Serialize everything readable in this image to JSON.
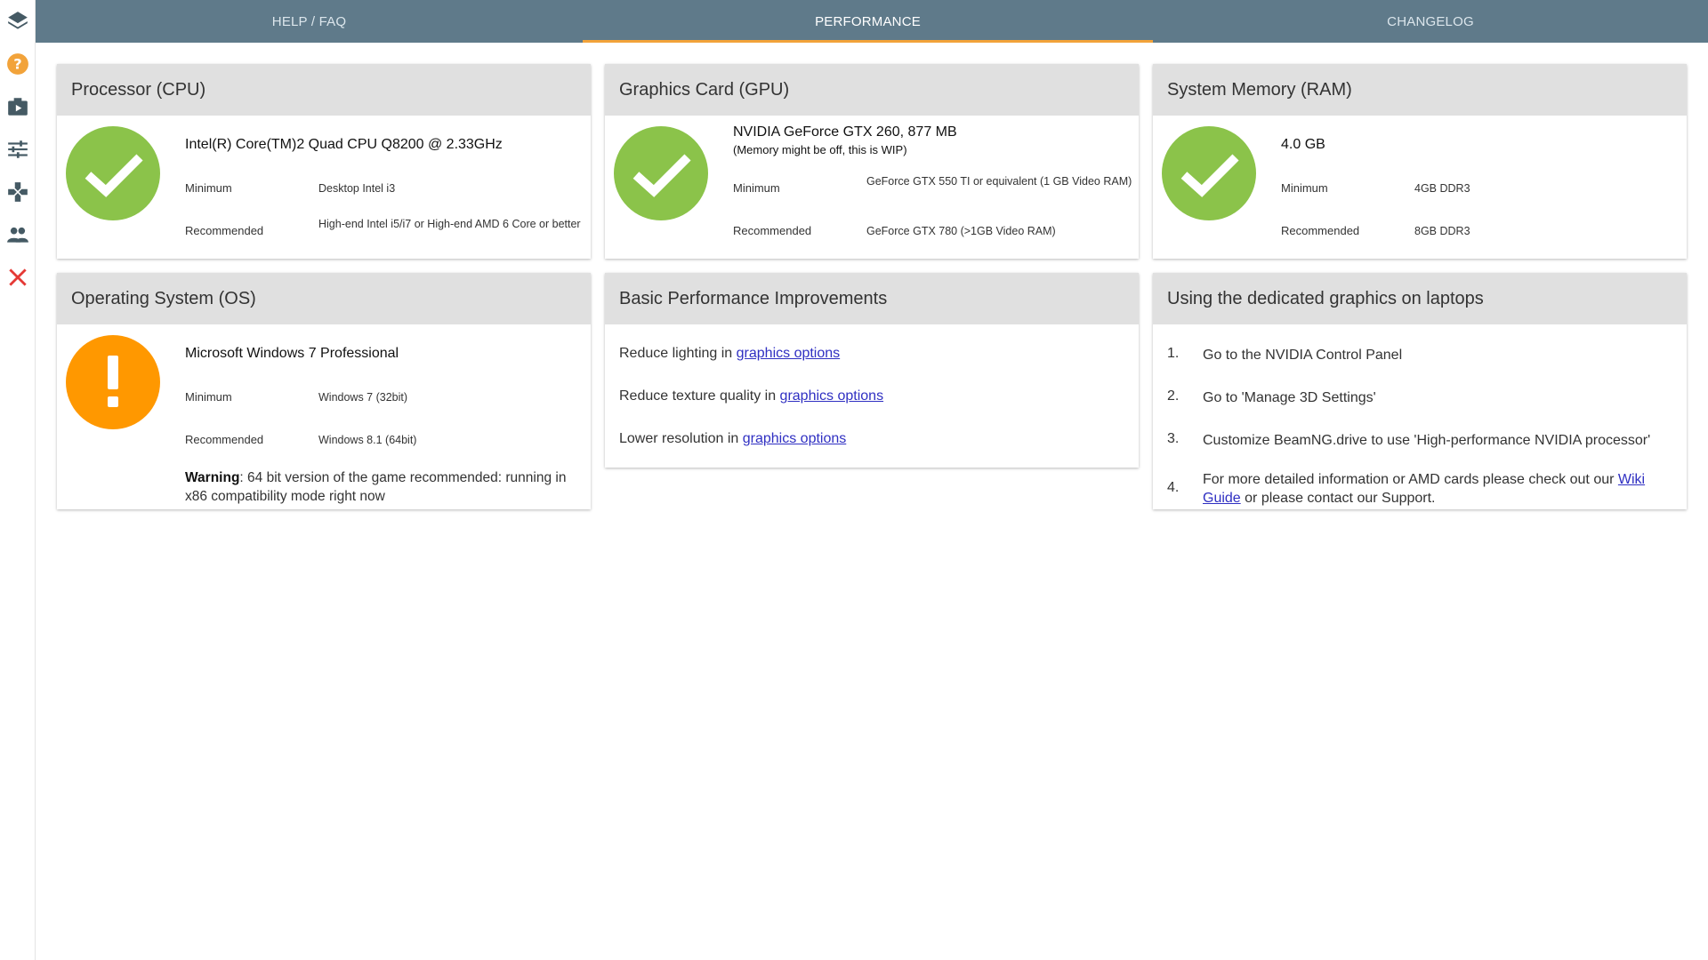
{
  "colors": {
    "topbar": "#5f7a8a",
    "active_underline": "#f2a33a",
    "ok": "#8bc34a",
    "warn": "#ff9800",
    "close": "#e53935",
    "link": "#2f2fc2"
  },
  "sidebar": {
    "items": [
      {
        "icon": "layers-icon"
      },
      {
        "icon": "help-icon"
      },
      {
        "icon": "media-play-icon"
      },
      {
        "icon": "tune-sliders-icon"
      },
      {
        "icon": "gamepad-icon"
      },
      {
        "icon": "people-icon"
      },
      {
        "icon": "close-icon"
      }
    ]
  },
  "tabs": [
    {
      "label": "HELP / FAQ"
    },
    {
      "label": "PERFORMANCE",
      "active": true
    },
    {
      "label": "CHANGELOG"
    }
  ],
  "cpu": {
    "title": "Processor (CPU)",
    "status": "ok",
    "value": "Intel(R) Core(TM)2 Quad CPU Q8200 @ 2.33GHz",
    "min_label": "Minimum",
    "min_value": "Desktop Intel i3",
    "rec_label": "Recommended",
    "rec_value": "High-end Intel i5/i7 or High-end AMD 6 Core or better"
  },
  "gpu": {
    "title": "Graphics Card (GPU)",
    "status": "ok",
    "value": "NVIDIA GeForce GTX 260, 877 MB",
    "note": "(Memory might be off, this is WIP)",
    "min_label": "Minimum",
    "min_value": "GeForce GTX 550 TI or equivalent (1 GB Video RAM)",
    "rec_label": "Recommended",
    "rec_value": "GeForce GTX 780 (>1GB Video RAM)"
  },
  "ram": {
    "title": "System Memory (RAM)",
    "status": "ok",
    "value": "4.0 GB",
    "min_label": "Minimum",
    "min_value": "4GB DDR3",
    "rec_label": "Recommended",
    "rec_value": "8GB DDR3"
  },
  "os": {
    "title": "Operating System (OS)",
    "status": "warn",
    "value": "Microsoft Windows 7 Professional",
    "min_label": "Minimum",
    "min_value": "Windows 7 (32bit)",
    "rec_label": "Recommended",
    "rec_value": "Windows 8.1 (64bit)",
    "warning_label": "Warning",
    "warning_text": ": 64 bit version of the game recommended: running in x86 compatibility mode right now"
  },
  "improvements": {
    "title": "Basic Performance Improvements",
    "items": [
      {
        "text": "Reduce lighting in ",
        "link": "graphics options"
      },
      {
        "text": "Reduce texture quality in ",
        "link": "graphics options"
      },
      {
        "text": "Lower resolution in ",
        "link": "graphics options"
      }
    ]
  },
  "laptops": {
    "title": "Using the dedicated graphics on laptops",
    "steps": [
      {
        "num": "1.",
        "text": "Go to the NVIDIA Control Panel"
      },
      {
        "num": "2.",
        "text": "Go to 'Manage 3D Settings'"
      },
      {
        "num": "3.",
        "text": "Customize BeamNG.drive to use 'High-performance NVIDIA processor'"
      },
      {
        "num": "4.",
        "text": "For more detailed information or AMD cards please check out our ",
        "link": "Wiki Guide",
        "text_after": " or please contact our Support."
      }
    ]
  }
}
